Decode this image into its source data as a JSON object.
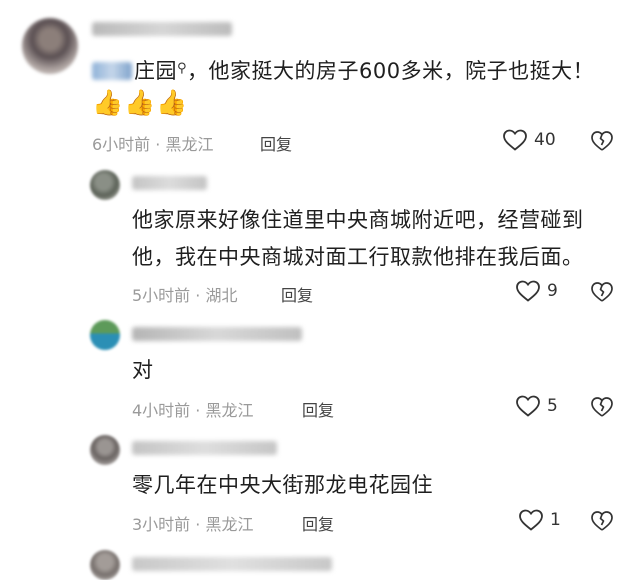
{
  "comments": [
    {
      "mention": "庄园",
      "text": "，他家挺大的房子600多米，院子也挺大！",
      "emoji": [
        "👍",
        "👍",
        "👍"
      ],
      "time": "6小时前",
      "location": "黑龙江",
      "reply_label": "回复",
      "likes": "40"
    },
    {
      "text_lines": [
        "他家原来好像住道里中央商城附近吧，经营碰到",
        "他，我在中央商城对面工行取款他排在我后面。"
      ],
      "time": "5小时前",
      "location": "湖北",
      "reply_label": "回复",
      "likes": "9"
    },
    {
      "text": "对",
      "time": "4小时前",
      "location": "黑龙江",
      "reply_label": "回复",
      "likes": "5"
    },
    {
      "text": "零几年在中央大街那龙电花园住",
      "time": "3小时前",
      "location": "黑龙江",
      "reply_label": "回复",
      "likes": "1"
    }
  ],
  "separator": "·",
  "icons": {
    "like": "heart-outline-icon",
    "dislike": "broken-heart-icon",
    "mention": "search-icon"
  }
}
